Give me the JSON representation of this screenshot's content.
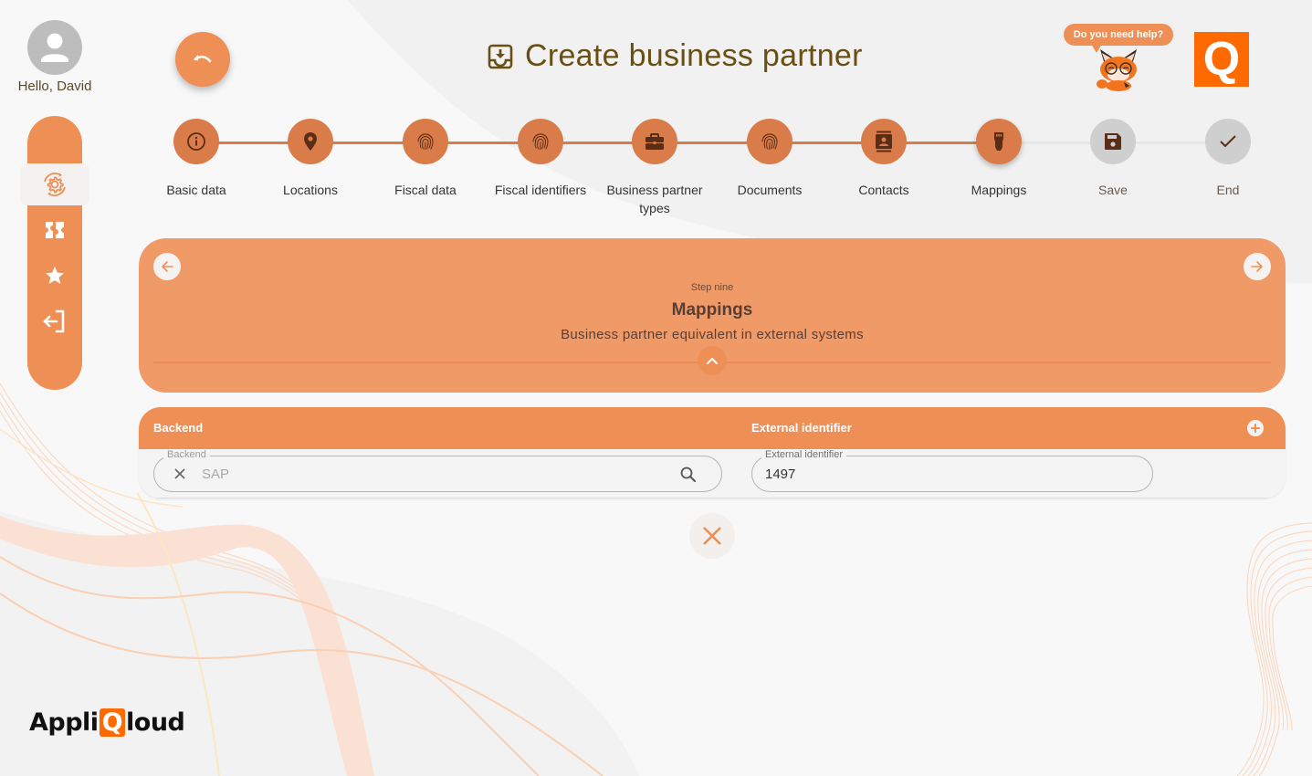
{
  "user": {
    "greeting": "Hello, David"
  },
  "sidebar": {
    "items": [
      {
        "icon": "settings-sync-icon",
        "active": true
      },
      {
        "icon": "ticket-icon",
        "active": false
      },
      {
        "icon": "star-icon",
        "active": false
      },
      {
        "icon": "logout-icon",
        "active": false
      }
    ]
  },
  "header": {
    "title": "Create business partner",
    "title_icon": "inbox-download-icon",
    "back_icon": "undo-icon",
    "help_text": "Do you need help?",
    "logo_letter": "Q"
  },
  "stepper": {
    "steps": [
      {
        "label": "Basic data",
        "icon": "info-icon",
        "state": "done"
      },
      {
        "label": "Locations",
        "icon": "location-pin-icon",
        "state": "done"
      },
      {
        "label": "Fiscal data",
        "icon": "fingerprint-icon",
        "state": "done"
      },
      {
        "label": "Fiscal identifiers",
        "icon": "fingerprint-icon",
        "state": "done"
      },
      {
        "label": "Business partner types",
        "icon": "briefcase-icon",
        "state": "done"
      },
      {
        "label": "Documents",
        "icon": "fingerprint-icon",
        "state": "done"
      },
      {
        "label": "Contacts",
        "icon": "contact-card-icon",
        "state": "done"
      },
      {
        "label": "Mappings",
        "icon": "connector-icon",
        "state": "current"
      },
      {
        "label": "Save",
        "icon": "floppy-disk-icon",
        "state": "pending"
      },
      {
        "label": "End",
        "icon": "check-icon",
        "state": "pending"
      }
    ]
  },
  "step_card": {
    "step_number_text": "Step nine",
    "title": "Mappings",
    "description": "Business partner equivalent in external systems"
  },
  "mappings_table": {
    "columns": [
      "Backend",
      "External identifier"
    ],
    "rows": [
      {
        "backend": {
          "label": "Backend",
          "value": "SAP"
        },
        "external_identifier": {
          "label": "External identifier",
          "value": "1497"
        }
      }
    ]
  },
  "footer": {
    "brand_prefix": "Appli",
    "brand_q": "Q",
    "brand_suffix": "loud"
  },
  "colors": {
    "accent": "#ee8f55",
    "step_done": "#d97c4a",
    "step_pending": "#cfcfcf",
    "icon_dark": "#5a2d17",
    "title": "#6a4f13",
    "logo": "#ff6a00"
  }
}
